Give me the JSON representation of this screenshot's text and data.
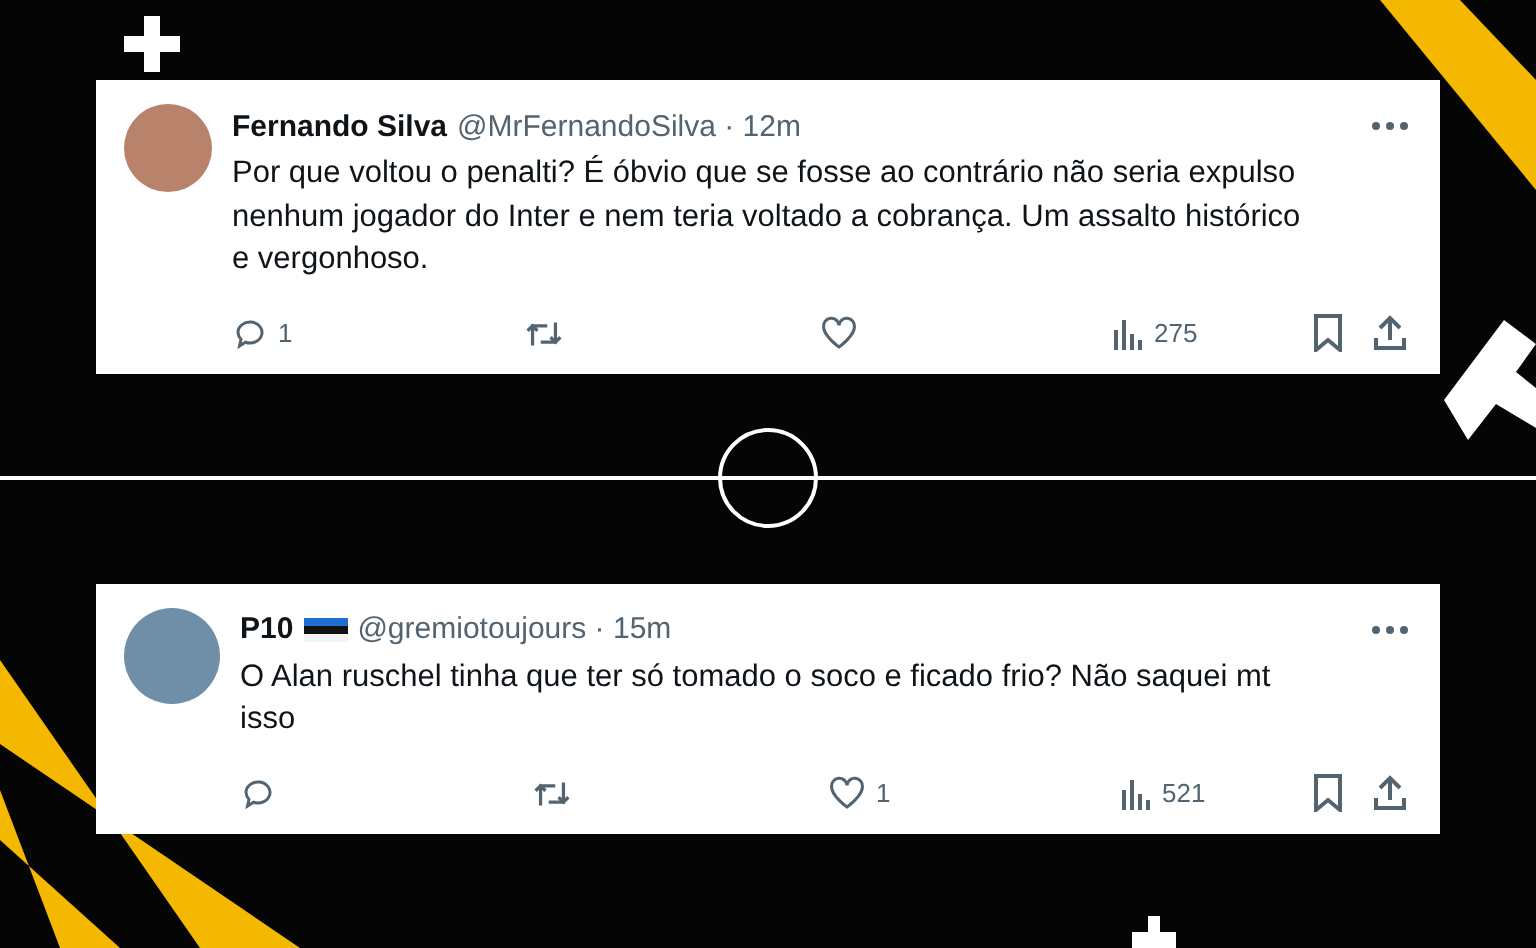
{
  "tweets": [
    {
      "name": "Fernando Silva",
      "handle": "@MrFernandoSilva",
      "separator": "·",
      "time": "12m",
      "flag": false,
      "text": "Por que voltou o penalti? É óbvio que se fosse ao contrário não seria expulso nenhum jogador do Inter e nem teria voltado a cobrança. Um assalto histórico e vergonhoso.",
      "replies": "1",
      "views": "275"
    },
    {
      "name": "P10",
      "handle": "@gremiotoujours",
      "separator": "·",
      "time": "15m",
      "flag": true,
      "text": "O Alan ruschel tinha que ter só tomado o soco e ficado frio? Não saquei mt isso",
      "likes": "1",
      "views": "521"
    }
  ]
}
